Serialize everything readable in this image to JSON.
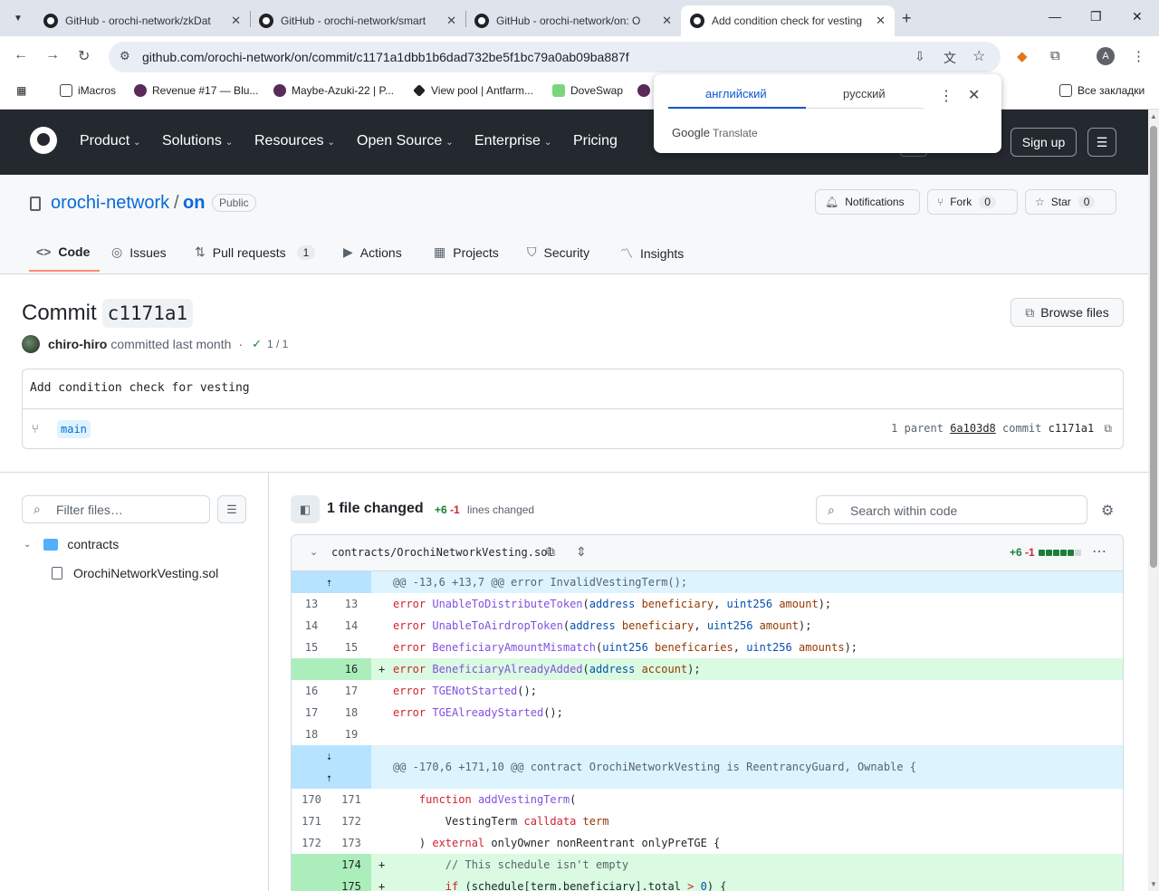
{
  "browser": {
    "tabs": [
      {
        "title": "GitHub - orochi-network/zkDat"
      },
      {
        "title": "GitHub - orochi-network/smart"
      },
      {
        "title": "GitHub - orochi-network/on: O"
      },
      {
        "title": "Add condition check for vesting"
      }
    ],
    "url": "github.com/orochi-network/on/commit/c1171a1dbb1b6dad732be5f1bc79a0ab09ba887f",
    "profile_initial": "A",
    "bookmarks": [
      {
        "label": "iMacros"
      },
      {
        "label": "Revenue #17 — Blu..."
      },
      {
        "label": "Maybe-Azuki-22 | P..."
      },
      {
        "label": "View pool | Antfarm..."
      },
      {
        "label": "DoveSwap"
      }
    ],
    "all_bookmarks": "Все закладки"
  },
  "translate": {
    "lang_from": "английский",
    "lang_to": "русский",
    "brand_google": "Google",
    "brand_translate": "Translate"
  },
  "gh_header": {
    "nav": [
      {
        "label": "Product",
        "chevron": true
      },
      {
        "label": "Solutions",
        "chevron": true
      },
      {
        "label": "Resources",
        "chevron": true
      },
      {
        "label": "Open Source",
        "chevron": true
      },
      {
        "label": "Enterprise",
        "chevron": true
      },
      {
        "label": "Pricing",
        "chevron": false
      }
    ],
    "signup": "Sign up"
  },
  "repo": {
    "owner": "orochi-network",
    "separator": "/",
    "name": "on",
    "visibility": "Public",
    "notifications": "Notifications",
    "fork_label": "Fork",
    "fork_count": "0",
    "star_label": "Star",
    "star_count": "0",
    "tabs": [
      {
        "label": "Code",
        "active": true
      },
      {
        "label": "Issues"
      },
      {
        "label": "Pull requests",
        "count": "1"
      },
      {
        "label": "Actions"
      },
      {
        "label": "Projects"
      },
      {
        "label": "Security"
      },
      {
        "label": "Insights"
      }
    ]
  },
  "commit": {
    "title_prefix": "Commit",
    "sha_short": "c1171a1",
    "browse_files": "Browse files",
    "author": "chiro-hiro",
    "action": "committed last month",
    "separator": "·",
    "checks": "1 / 1",
    "message": "Add condition check for vesting",
    "branch": "main",
    "parent_count": "1 parent",
    "parent_sha": "6a103d8",
    "commit_label": "commit",
    "commit_sha": "c1171a1"
  },
  "files": {
    "filter_placeholder": "Filter files…",
    "folder": "contracts",
    "file": "OrochiNetworkVesting.sol"
  },
  "diff": {
    "summary": "1 file changed",
    "additions": "+6",
    "deletions": "-1",
    "lines_changed": "lines changed",
    "search_placeholder": "Search within code",
    "file_path": "contracts/OrochiNetworkVesting.sol",
    "file_additions": "+6",
    "file_deletions": "-1",
    "stat_blocks": [
      "#1a7f37",
      "#1a7f37",
      "#1a7f37",
      "#1a7f37",
      "#1a7f37",
      "#d1d9e0"
    ]
  }
}
